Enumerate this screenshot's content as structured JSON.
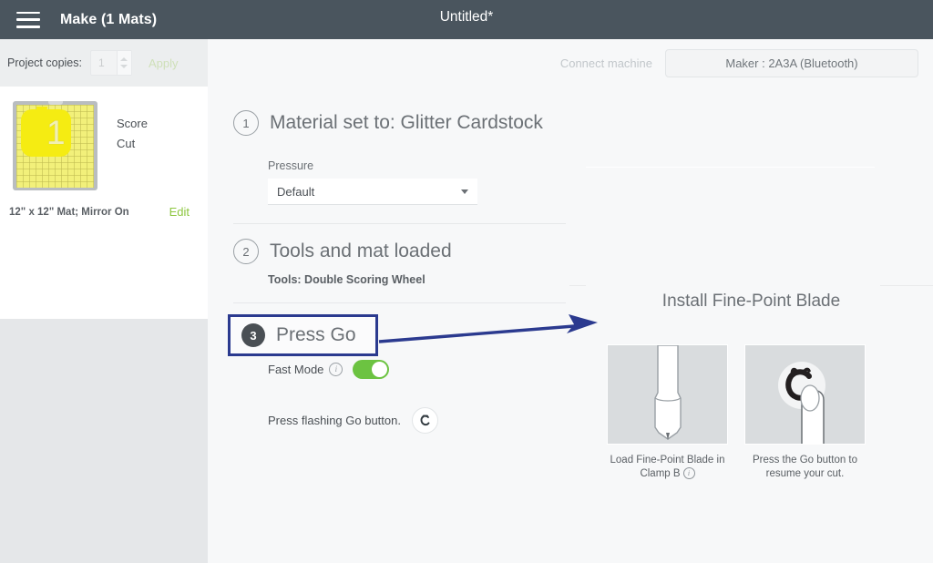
{
  "topbar": {
    "menu_icon": "hamburger-icon",
    "make_title": "Make (1 Mats)",
    "doc_title": "Untitled*"
  },
  "subbar": {
    "copies_label": "Project copies:",
    "copies_value": "1",
    "apply_label": "Apply",
    "connect_label": "Connect machine",
    "machine_button": "Maker : 2A3A (Bluetooth)"
  },
  "mat_panel": {
    "mat_number": "1",
    "operations": [
      "Score",
      "Cut"
    ],
    "meta": "12\" x 12\" Mat; Mirror On",
    "edit_label": "Edit"
  },
  "steps": {
    "step1": {
      "number": "1",
      "title": "Material set to: Glitter Cardstock",
      "pressure_label": "Pressure",
      "pressure_value": "Default"
    },
    "step2": {
      "number": "2",
      "title": "Tools and mat loaded",
      "tools_line": "Tools: Double Scoring Wheel"
    },
    "step3": {
      "number": "3",
      "title": "Press Go",
      "fast_mode_label": "Fast Mode",
      "fast_mode_info": "i",
      "fast_mode_state": "on",
      "press_go_text": "Press flashing Go button.",
      "go_button_icon": "cricut-c-icon"
    }
  },
  "right_panel": {
    "title": "Install Fine-Point Blade",
    "cards": [
      {
        "image": "fine-point-blade-illustration",
        "caption_line1": "Load Fine-Point Blade in",
        "caption_line2": "Clamp B",
        "info": "i"
      },
      {
        "image": "finger-pressing-go-button-illustration",
        "caption_line1": "Press the Go button to",
        "caption_line2": "resume your cut."
      }
    ]
  },
  "annotation": {
    "arrow_color": "#2b3a8f",
    "highlight_color": "#2b3a8f"
  },
  "colors": {
    "topbar_bg": "#4a555e",
    "accent_green": "#8dc63f",
    "toggle_green": "#6cc341",
    "mat_yellow": "#f5ec12"
  }
}
